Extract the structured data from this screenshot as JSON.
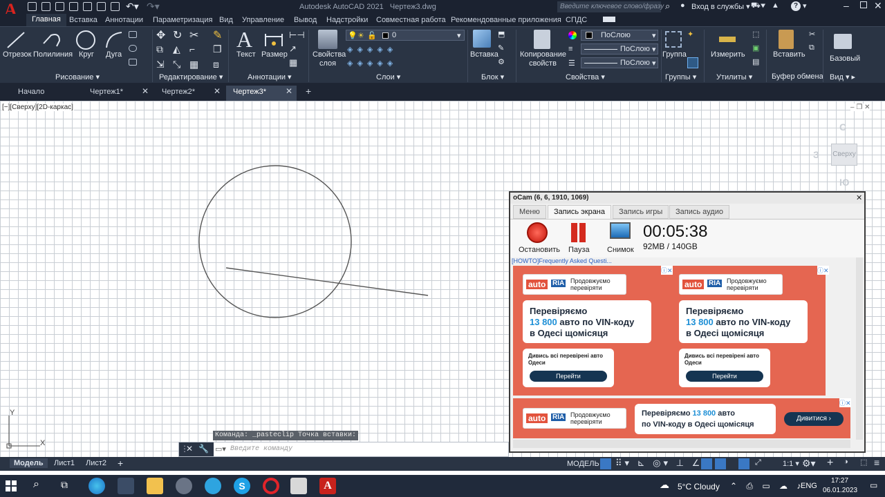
{
  "app": {
    "title": "Autodesk AutoCAD 2021",
    "filename": "Чертеж3.dwg",
    "search_placeholder": "Введите ключевое слово/фразу",
    "login": "Вход в службы",
    "help": "?"
  },
  "menu": [
    "Главная",
    "Вставка",
    "Аннотации",
    "Параметризация",
    "Вид",
    "Управление",
    "Вывод",
    "Надстройки",
    "Совместная работа",
    "Рекомендованные приложения",
    "СПДС"
  ],
  "ribbon": {
    "draw": {
      "items": [
        "Отрезок",
        "Полилиния",
        "Круг",
        "Дуга"
      ],
      "group": "Рисование"
    },
    "modify": {
      "group": "Редактирование"
    },
    "annot": {
      "items": [
        "Текст",
        "Размер"
      ],
      "group": "Аннотации"
    },
    "layers": {
      "props": "Свойства слоя",
      "layer_value": "0",
      "group": "Слои"
    },
    "block": {
      "item": "Вставка",
      "group": "Блок"
    },
    "properties": {
      "copy": "Копирование свойств",
      "bylayer1": "ПоСлою",
      "bylayer2": "ПоСлою",
      "bylayer3": "ПоСлою",
      "group": "Свойства"
    },
    "groups": {
      "item": "Группа",
      "group": "Группы"
    },
    "utils": {
      "item": "Измерить",
      "group": "Утилиты"
    },
    "clipboard": {
      "item": "Вставить",
      "group": "Буфер обмена"
    },
    "view": {
      "item": "Базовый",
      "group": "Вид"
    }
  },
  "doc_tabs": [
    "Начало",
    "Чертеж1*",
    "Чертеж2*",
    "Чертеж3*"
  ],
  "viewport": {
    "label": "[−][Сверху][2D-каркас]",
    "viewcube": "Сверху",
    "north": "С",
    "west": "З",
    "south": "Ю",
    "ucs_x": "X",
    "ucs_y": "Y"
  },
  "command": {
    "history": "Команда: _pasteclip Точка вставки:",
    "placeholder": "Введите команду"
  },
  "layout_tabs": [
    "Модель",
    "Лист1",
    "Лист2"
  ],
  "status": {
    "model": "МОДЕЛЬ",
    "scale": "1:1"
  },
  "ocam": {
    "title": "oCam (6, 6, 1910, 1069)",
    "tabs": [
      "Меню",
      "Запись экрана",
      "Запись игры",
      "Запись аудио"
    ],
    "buttons": [
      "Остановить",
      "Пауза",
      "Снимок"
    ],
    "timer": "00:05:38",
    "size": "92MB / 140GB",
    "link": "[HOWTO]Frequently Asked Questi...",
    "ad": {
      "brand1": "auto",
      "brand2": "RIA",
      "tag": "Продовжуємо перевіряти",
      "head1": "Перевіряємо",
      "num": "13 800",
      "head2": "авто по VIN-коду",
      "head3": "в Одесі щомісяця",
      "sub": "Дивись всі перевірені авто Одеси",
      "btn": "Перейти",
      "banner_line1a": "Перевіряємо",
      "banner_line1c": "авто",
      "banner_line2": "по VIN-коду в Одесі щомісяця",
      "banner_btn": "Дивитися ›"
    }
  },
  "taskbar": {
    "weather": "5°C  Cloudy",
    "lang": "ENG",
    "time": "17:27",
    "date": "06.01.2023"
  }
}
